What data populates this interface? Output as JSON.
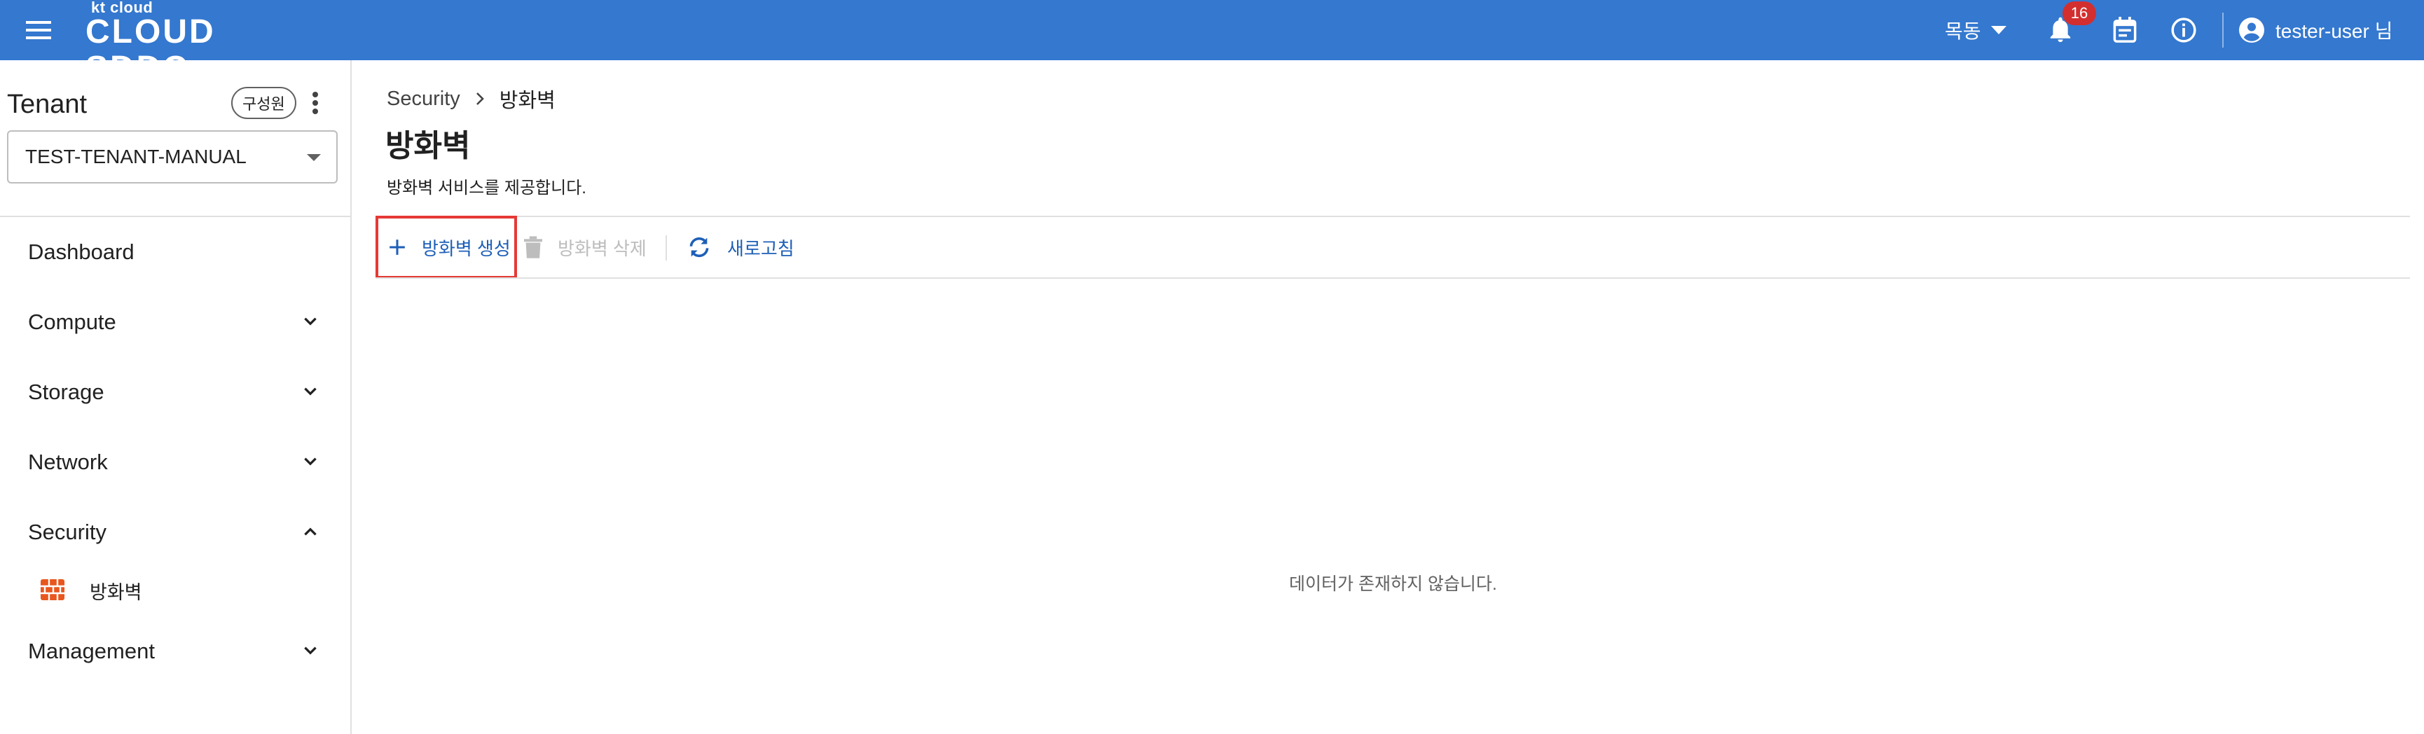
{
  "header": {
    "logo_small": "kt cloud",
    "logo_big": "CLOUD SDDC",
    "region": "목동",
    "notification_count": "16",
    "user": "tester-user 님",
    "colors": {
      "bar": "#3478cf",
      "badge": "#d32f2f"
    }
  },
  "sidebar": {
    "tenant_title": "Tenant",
    "members_label": "구성원",
    "tenant_selected": "TEST-TENANT-MANUAL",
    "items": [
      {
        "label": "Dashboard",
        "expandable": false
      },
      {
        "label": "Compute",
        "expandable": true,
        "expanded": false
      },
      {
        "label": "Storage",
        "expandable": true,
        "expanded": false
      },
      {
        "label": "Network",
        "expandable": true,
        "expanded": false
      },
      {
        "label": "Security",
        "expandable": true,
        "expanded": true
      },
      {
        "label": "Management",
        "expandable": true,
        "expanded": false
      }
    ],
    "security_sub": [
      {
        "label": "방화벽",
        "icon": "firewall-icon"
      }
    ]
  },
  "main": {
    "breadcrumb": {
      "parent": "Security",
      "current": "방화벽"
    },
    "title": "방화벽",
    "description": "방화벽 서비스를 제공합니다.",
    "toolbar": {
      "create_label": "방화벽 생성",
      "delete_label": "방화벽 삭제",
      "refresh_label": "새로고침"
    },
    "empty_message": "데이터가 존재하지 않습니다."
  }
}
